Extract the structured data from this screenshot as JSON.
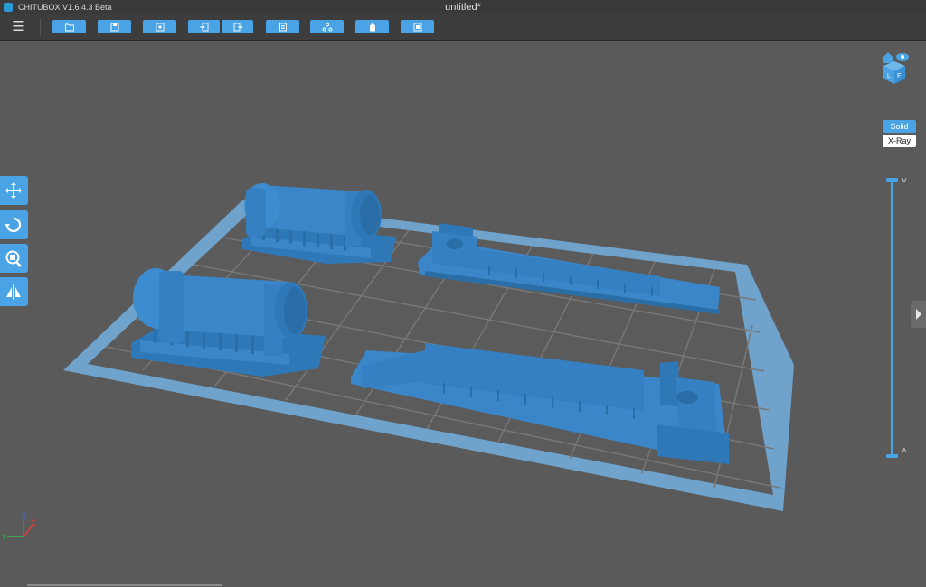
{
  "app": {
    "name": "CHITUBOX V1.6.4.3 Beta",
    "document_title": "untitled*"
  },
  "toolbar": {
    "buttons": [
      {
        "name": "open-file",
        "icon": "folder-icon"
      },
      {
        "name": "save-file",
        "icon": "save-icon"
      },
      {
        "name": "auto-layout",
        "icon": "layout-icon"
      },
      {
        "name": "import",
        "icon": "import-icon"
      },
      {
        "name": "export",
        "icon": "export-icon"
      },
      {
        "name": "settings",
        "icon": "settings-icon"
      },
      {
        "name": "supports",
        "icon": "supports-icon"
      },
      {
        "name": "hollow",
        "icon": "hollow-icon"
      },
      {
        "name": "slice",
        "icon": "slice-icon"
      }
    ]
  },
  "left_tools": [
    {
      "name": "move",
      "icon": "move-icon"
    },
    {
      "name": "rotate",
      "icon": "rotate-icon"
    },
    {
      "name": "scale",
      "icon": "scale-icon"
    },
    {
      "name": "mirror",
      "icon": "mirror-icon"
    }
  ],
  "view_mode": {
    "solid_label": "Solid",
    "xray_label": "X-Ray",
    "selected": "Solid"
  },
  "colors": {
    "accent": "#4aa3e4",
    "model": "#3a86c8",
    "background": "#5a5a5a"
  },
  "axis": {
    "x": "X",
    "y": "Y",
    "z": "Z"
  }
}
